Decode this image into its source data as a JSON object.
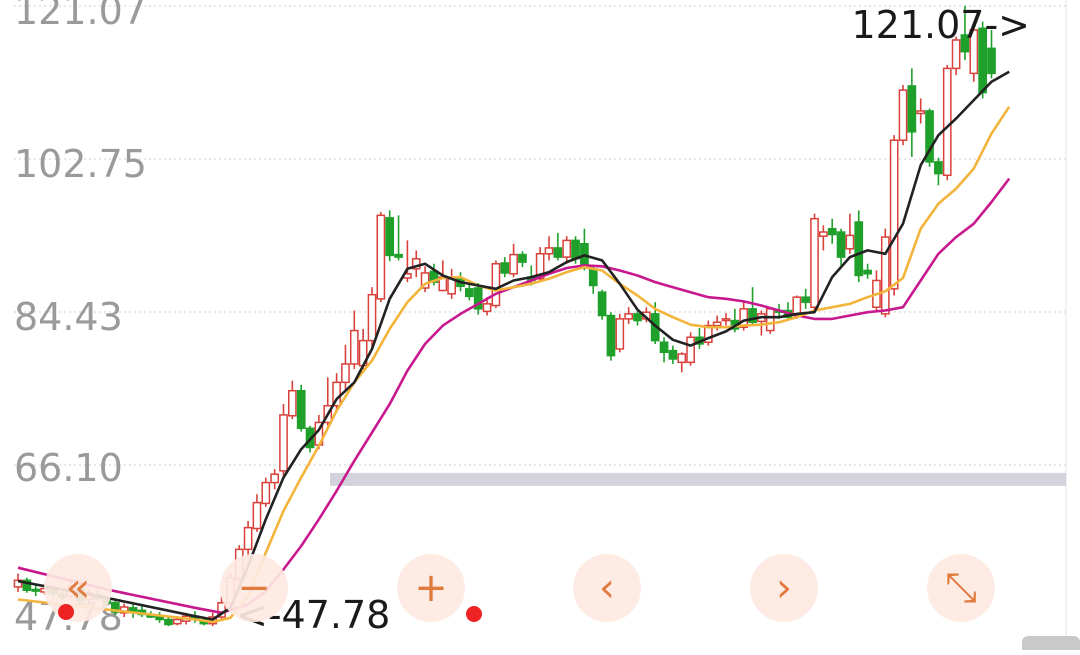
{
  "colors": {
    "up": "#d9403a",
    "down": "#1fa02a",
    "ma_short": "#222222",
    "ma_mid": "#f2b43a",
    "ma_long": "#c8188e",
    "grid": "#cfcfcf",
    "band": "#d3d3dd",
    "control_bg": "#fde9e2",
    "control_fg": "#e07a3d",
    "dot": "#ee2222"
  },
  "chart_data": {
    "type": "candlestick",
    "y_ticks": [
      "121.07",
      "102.75",
      "84.43",
      "66.10",
      "47.78"
    ],
    "ylim": [
      47.78,
      121.07
    ],
    "max_label": "121.07->",
    "min_label": "<-47.78",
    "max_value": 121.07,
    "min_value": 47.78,
    "band_value": 64.2,
    "candles": [
      [
        51.5,
        52.3,
        53.1,
        50.9
      ],
      [
        52.3,
        51.1,
        52.6,
        50.8
      ],
      [
        51.2,
        51.0,
        51.9,
        50.4
      ],
      [
        50.9,
        51.3,
        51.8,
        50.6
      ],
      [
        51.3,
        50.7,
        51.6,
        50.1
      ],
      [
        50.6,
        50.3,
        51.0,
        49.9
      ],
      [
        50.4,
        51.6,
        52.3,
        50.1
      ],
      [
        51.4,
        49.9,
        51.8,
        49.3
      ],
      [
        50.0,
        50.8,
        51.2,
        49.6
      ],
      [
        50.6,
        50.1,
        51.2,
        49.8
      ],
      [
        50.0,
        49.6,
        50.4,
        49.2
      ],
      [
        49.6,
        48.5,
        49.9,
        48.1
      ],
      [
        48.4,
        49.1,
        49.5,
        47.9
      ],
      [
        49.0,
        48.6,
        49.6,
        47.8
      ],
      [
        48.7,
        48.2,
        49.2,
        47.9
      ],
      [
        48.2,
        47.9,
        48.6,
        47.8
      ],
      [
        48.0,
        47.6,
        48.5,
        47.2
      ],
      [
        47.6,
        47.0,
        48.0,
        46.8
      ],
      [
        47.1,
        47.6,
        48.0,
        46.9
      ],
      [
        47.4,
        48.0,
        48.4,
        47.0
      ],
      [
        48.0,
        47.6,
        48.6,
        47.2
      ],
      [
        47.5,
        47.1,
        47.9,
        46.9
      ],
      [
        47.1,
        47.9,
        48.4,
        46.8
      ],
      [
        47.9,
        49.6,
        50.4,
        47.6
      ],
      [
        49.5,
        52.6,
        53.1,
        49.1
      ],
      [
        52.5,
        56.0,
        56.5,
        52.2
      ],
      [
        56.0,
        58.6,
        59.4,
        55.0
      ],
      [
        58.5,
        61.6,
        62.6,
        58.1
      ],
      [
        61.5,
        64.0,
        64.6,
        61.1
      ],
      [
        64.0,
        65.0,
        65.6,
        63.2
      ],
      [
        65.4,
        72.1,
        73.4,
        64.8
      ],
      [
        72.0,
        75.0,
        76.2,
        71.6
      ],
      [
        75.0,
        70.5,
        75.7,
        70.1
      ],
      [
        70.5,
        68.2,
        70.8,
        67.6
      ],
      [
        68.5,
        71.2,
        72.1,
        68.0
      ],
      [
        71.2,
        73.2,
        76.6,
        70.8
      ],
      [
        73.2,
        76.0,
        77.1,
        72.4
      ],
      [
        76.0,
        78.2,
        80.5,
        75.1
      ],
      [
        78.2,
        82.2,
        84.6,
        77.6
      ],
      [
        78.0,
        81.0,
        82.4,
        77.6
      ],
      [
        81.0,
        86.5,
        87.4,
        80.2
      ],
      [
        86.0,
        96.0,
        96.4,
        85.6
      ],
      [
        95.7,
        91.2,
        96.6,
        90.5
      ],
      [
        91.3,
        91.0,
        96.0,
        90.6
      ],
      [
        88.5,
        89.0,
        93.0,
        88.0
      ],
      [
        89.6,
        90.8,
        91.8,
        88.6
      ],
      [
        87.3,
        89.1,
        89.9,
        86.8
      ],
      [
        89.3,
        88.0,
        90.2,
        87.6
      ],
      [
        87.0,
        88.6,
        90.6,
        86.9
      ],
      [
        86.6,
        88.4,
        89.6,
        86.0
      ],
      [
        88.4,
        87.5,
        89.2,
        86.9
      ],
      [
        87.2,
        86.3,
        88.0,
        85.8
      ],
      [
        87.3,
        84.8,
        87.9,
        84.1
      ],
      [
        84.5,
        85.4,
        86.2,
        84.0
      ],
      [
        85.2,
        90.2,
        90.6,
        84.9
      ],
      [
        90.3,
        89.1,
        91.0,
        88.6
      ],
      [
        89.0,
        91.3,
        92.6,
        88.6
      ],
      [
        91.3,
        90.4,
        91.7,
        89.8
      ],
      [
        88.6,
        88.2,
        90.0,
        87.6
      ],
      [
        88.4,
        91.4,
        92.2,
        88.0
      ],
      [
        91.4,
        92.1,
        93.5,
        90.6
      ],
      [
        92.1,
        91.0,
        93.9,
        90.6
      ],
      [
        91.0,
        93.0,
        93.5,
        90.2
      ],
      [
        93.0,
        90.8,
        93.5,
        90.2
      ],
      [
        92.6,
        89.9,
        94.4,
        89.4
      ],
      [
        89.6,
        87.6,
        89.9,
        86.6
      ],
      [
        86.8,
        84.0,
        87.1,
        83.5
      ],
      [
        84.0,
        79.2,
        84.4,
        78.6
      ],
      [
        80.0,
        83.6,
        84.2,
        79.6
      ],
      [
        83.6,
        84.2,
        85.0,
        83.0
      ],
      [
        84.2,
        83.4,
        84.8,
        82.8
      ],
      [
        83.6,
        84.4,
        85.0,
        83.2
      ],
      [
        84.2,
        81.0,
        85.6,
        80.6
      ],
      [
        80.8,
        79.6,
        81.4,
        78.4
      ],
      [
        79.8,
        78.8,
        80.4,
        78.2
      ],
      [
        78.4,
        79.4,
        79.6,
        77.2
      ],
      [
        78.4,
        81.4,
        82.0,
        78.0
      ],
      [
        81.4,
        80.6,
        82.5,
        80.0
      ],
      [
        80.8,
        82.8,
        83.4,
        80.4
      ],
      [
        82.8,
        83.2,
        84.0,
        82.2
      ],
      [
        83.4,
        83.6,
        84.3,
        82.8
      ],
      [
        83.4,
        82.4,
        84.8,
        82.0
      ],
      [
        82.6,
        84.8,
        85.8,
        82.2
      ],
      [
        84.8,
        83.2,
        87.4,
        82.8
      ],
      [
        83.3,
        84.2,
        84.6,
        81.6
      ],
      [
        82.2,
        84.8,
        85.0,
        81.8
      ],
      [
        84.6,
        84.4,
        85.4,
        83.6
      ],
      [
        84.6,
        83.8,
        85.6,
        83.4
      ],
      [
        84.0,
        86.2,
        86.4,
        83.6
      ],
      [
        86.2,
        85.6,
        87.2,
        84.8
      ],
      [
        85.0,
        95.6,
        96.2,
        84.6
      ],
      [
        93.5,
        94.0,
        94.8,
        91.8
      ],
      [
        94.4,
        93.7,
        95.6,
        92.6
      ],
      [
        94.0,
        91.0,
        94.4,
        90.0
      ],
      [
        92.0,
        93.6,
        96.2,
        91.4
      ],
      [
        95.2,
        88.8,
        96.6,
        88.0
      ],
      [
        89.4,
        89.0,
        90.2,
        88.4
      ],
      [
        85.0,
        88.2,
        89.4,
        84.6
      ],
      [
        84.2,
        93.4,
        94.4,
        83.8
      ],
      [
        87.2,
        105.0,
        105.6,
        86.4
      ],
      [
        105.0,
        111.0,
        111.6,
        104.4
      ],
      [
        111.5,
        106.0,
        113.6,
        103.0
      ],
      [
        108.2,
        108.5,
        110.0,
        107.0
      ],
      [
        108.5,
        102.4,
        108.8,
        101.8
      ],
      [
        102.4,
        101.0,
        102.9,
        99.6
      ],
      [
        100.8,
        113.6,
        114.0,
        100.2
      ],
      [
        113.6,
        117.0,
        117.4,
        112.8
      ],
      [
        117.6,
        115.6,
        121.1,
        114.6
      ],
      [
        113.0,
        118.2,
        118.9,
        112.0
      ],
      [
        118.4,
        110.7,
        119.2,
        110.0
      ],
      [
        116.0,
        113.0,
        118.2,
        112.4
      ]
    ],
    "ma_short": [
      [
        0,
        52.2
      ],
      [
        10,
        50.2
      ],
      [
        20,
        48.0
      ],
      [
        22,
        47.6
      ],
      [
        24,
        49.0
      ],
      [
        26,
        54.0
      ],
      [
        28,
        59.6
      ],
      [
        30,
        64.6
      ],
      [
        32,
        68.0
      ],
      [
        34,
        70.3
      ],
      [
        36,
        74.0
      ],
      [
        38,
        76.0
      ],
      [
        40,
        80.0
      ],
      [
        42,
        86.0
      ],
      [
        44,
        89.6
      ],
      [
        46,
        90.2
      ],
      [
        48,
        88.8
      ],
      [
        50,
        88.0
      ],
      [
        52,
        87.6
      ],
      [
        54,
        87.2
      ],
      [
        56,
        88.2
      ],
      [
        58,
        88.6
      ],
      [
        60,
        89.2
      ],
      [
        62,
        90.4
      ],
      [
        64,
        91.2
      ],
      [
        66,
        90.6
      ],
      [
        68,
        87.8
      ],
      [
        70,
        84.7
      ],
      [
        72,
        82.8
      ],
      [
        74,
        81.1
      ],
      [
        76,
        80.4
      ],
      [
        78,
        81.3
      ],
      [
        80,
        82.1
      ],
      [
        82,
        83.4
      ],
      [
        84,
        83.8
      ],
      [
        86,
        83.8
      ],
      [
        88,
        84.2
      ],
      [
        90,
        84.4
      ],
      [
        92,
        88.6
      ],
      [
        94,
        91.0
      ],
      [
        96,
        91.8
      ],
      [
        98,
        91.4
      ],
      [
        100,
        95.0
      ],
      [
        102,
        102.0
      ],
      [
        104,
        105.6
      ],
      [
        106,
        107.6
      ],
      [
        108,
        109.8
      ],
      [
        110,
        112.0
      ],
      [
        112,
        113.2
      ]
    ],
    "ma_mid": [
      [
        0,
        50.0
      ],
      [
        10,
        48.8
      ],
      [
        20,
        47.6
      ],
      [
        22,
        47.3
      ],
      [
        24,
        47.8
      ],
      [
        26,
        50.4
      ],
      [
        28,
        55.6
      ],
      [
        30,
        60.6
      ],
      [
        32,
        64.6
      ],
      [
        34,
        68.4
      ],
      [
        36,
        72.6
      ],
      [
        38,
        76.0
      ],
      [
        40,
        78.6
      ],
      [
        42,
        82.4
      ],
      [
        44,
        85.6
      ],
      [
        46,
        87.8
      ],
      [
        48,
        88.5
      ],
      [
        50,
        88.6
      ],
      [
        52,
        87.6
      ],
      [
        54,
        87.0
      ],
      [
        56,
        87.4
      ],
      [
        58,
        87.8
      ],
      [
        60,
        88.4
      ],
      [
        62,
        89.2
      ],
      [
        64,
        89.8
      ],
      [
        66,
        89.4
      ],
      [
        68,
        87.8
      ],
      [
        70,
        86.4
      ],
      [
        72,
        84.8
      ],
      [
        74,
        83.8
      ],
      [
        76,
        82.9
      ],
      [
        78,
        82.6
      ],
      [
        80,
        82.6
      ],
      [
        82,
        82.8
      ],
      [
        84,
        82.9
      ],
      [
        86,
        83.2
      ],
      [
        88,
        83.8
      ],
      [
        90,
        84.6
      ],
      [
        92,
        85.0
      ],
      [
        94,
        85.4
      ],
      [
        96,
        86.2
      ],
      [
        98,
        86.9
      ],
      [
        100,
        88.5
      ],
      [
        102,
        94.4
      ],
      [
        104,
        97.4
      ],
      [
        106,
        99.2
      ],
      [
        108,
        101.6
      ],
      [
        110,
        105.8
      ],
      [
        112,
        109.0
      ]
    ],
    "ma_long": [
      [
        0,
        53.8
      ],
      [
        10,
        51.2
      ],
      [
        20,
        49.0
      ],
      [
        23,
        48.4
      ],
      [
        26,
        49.4
      ],
      [
        28,
        51.0
      ],
      [
        30,
        53.6
      ],
      [
        32,
        56.4
      ],
      [
        34,
        59.6
      ],
      [
        36,
        63.0
      ],
      [
        38,
        66.6
      ],
      [
        40,
        70.0
      ],
      [
        42,
        73.4
      ],
      [
        44,
        77.4
      ],
      [
        46,
        80.6
      ],
      [
        48,
        82.8
      ],
      [
        50,
        84.2
      ],
      [
        52,
        85.4
      ],
      [
        54,
        86.6
      ],
      [
        56,
        87.4
      ],
      [
        58,
        88.2
      ],
      [
        60,
        89.0
      ],
      [
        62,
        89.7
      ],
      [
        64,
        90.0
      ],
      [
        66,
        89.9
      ],
      [
        68,
        89.4
      ],
      [
        70,
        88.8
      ],
      [
        72,
        88.0
      ],
      [
        74,
        87.4
      ],
      [
        76,
        86.8
      ],
      [
        78,
        86.2
      ],
      [
        80,
        86.0
      ],
      [
        82,
        85.7
      ],
      [
        84,
        85.2
      ],
      [
        86,
        84.6
      ],
      [
        88,
        84.0
      ],
      [
        90,
        83.6
      ],
      [
        92,
        83.6
      ],
      [
        94,
        84.0
      ],
      [
        96,
        84.4
      ],
      [
        98,
        84.6
      ],
      [
        100,
        85.0
      ],
      [
        102,
        88.2
      ],
      [
        104,
        91.4
      ],
      [
        106,
        93.4
      ],
      [
        108,
        95.0
      ],
      [
        110,
        97.6
      ],
      [
        112,
        100.4
      ]
    ]
  },
  "controls": [
    {
      "name": "scroll-far-left-button",
      "glyph": "«"
    },
    {
      "name": "zoom-out-button",
      "glyph": "−"
    },
    {
      "name": "zoom-in-button",
      "glyph": "+"
    },
    {
      "name": "scroll-left-button",
      "glyph": "‹"
    },
    {
      "name": "scroll-right-button",
      "glyph": "›"
    },
    {
      "name": "fullscreen-button",
      "glyph": "⤡"
    }
  ]
}
